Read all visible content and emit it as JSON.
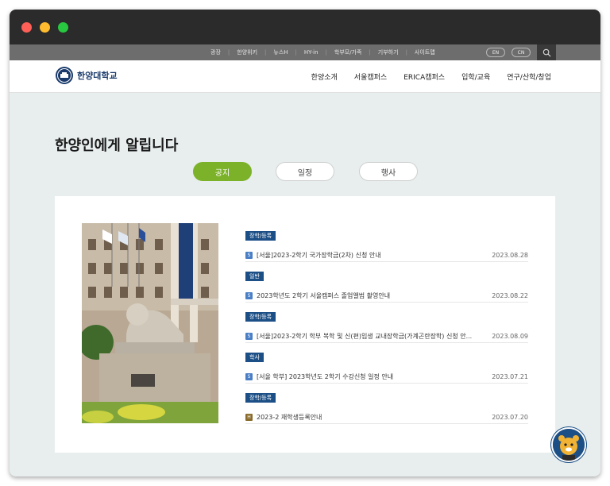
{
  "utility_bar": {
    "items": [
      "광장",
      "한양위키",
      "뉴스H",
      "HY-in",
      "학부모/가족",
      "기부하기",
      "사이트맵"
    ],
    "lang": [
      "EN",
      "CN"
    ]
  },
  "logo": {
    "text": "한양대학교"
  },
  "nav": {
    "items": [
      "한양소개",
      "서울캠퍼스",
      "ERICA캠퍼스",
      "입학/교육",
      "연구/산학/창업"
    ]
  },
  "heading": "한양인에게 알립니다",
  "tabs": [
    "공지",
    "일정",
    "행사"
  ],
  "notices": [
    {
      "category": "장학/등록",
      "badge": "S",
      "title": "[서울]2023-2학기 국가장학금(2차) 신청 안내",
      "date": "2023.08.28"
    },
    {
      "category": "일반",
      "badge": "S",
      "title": "2023학년도 2학기 서울캠퍼스 졸업앨범 촬영안내",
      "date": "2023.08.22"
    },
    {
      "category": "장학/등록",
      "badge": "S",
      "title": "[서울]2023-2학기 학부 복학 및 신(편)입생 교내장학금(가계곤란장학) 신청 안...",
      "date": "2023.08.09"
    },
    {
      "category": "학사",
      "badge": "S",
      "title": "[서울 학부] 2023학년도 2학기 수강신청 일정 안내",
      "date": "2023.07.21"
    },
    {
      "category": "장학/등록",
      "badge": "H",
      "title": "2023-2 재학생등록안내",
      "date": "2023.07.20"
    }
  ],
  "colors": {
    "accent_green": "#7cb229",
    "navy": "#1c4f86"
  }
}
